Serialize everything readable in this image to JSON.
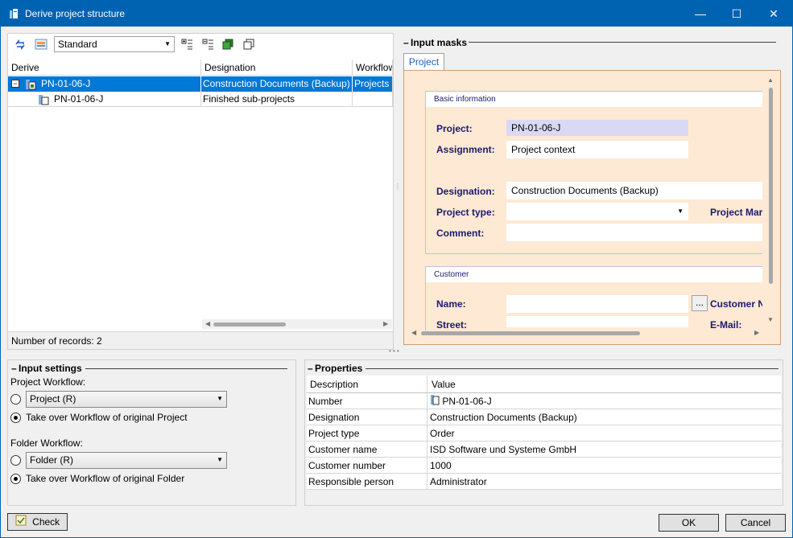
{
  "window": {
    "title": "Derive project structure"
  },
  "toolbar": {
    "view_combo": "Standard"
  },
  "tree": {
    "columns": [
      "Derive",
      "Designation",
      "Workflow"
    ],
    "rows": [
      {
        "derive": "PN-01-06-J",
        "designation": "Construction Documents (Backup)",
        "workflow": "Projects"
      },
      {
        "derive": "PN-01-06-J",
        "designation": "Finished sub-projects",
        "workflow": ""
      }
    ],
    "record_count": "Number of records: 2"
  },
  "input_masks": {
    "title": "Input masks",
    "tab": "Project",
    "basic_info": {
      "title": "Basic information",
      "project_label": "Project:",
      "project_value": "PN-01-06-J",
      "assignment_label": "Assignment:",
      "assignment_value": "Project context",
      "designation_label": "Designation:",
      "designation_value": "Construction Documents (Backup)",
      "project_type_label": "Project type:",
      "project_type_value": "",
      "project_manager_label": "Project Mar",
      "comment_label": "Comment:",
      "comment_value": ""
    },
    "customer": {
      "title": "Customer",
      "name_label": "Name:",
      "name_value": "",
      "browse_label": "...",
      "customer_number_label": "Customer N",
      "street_label": "Street:",
      "email_label": "E-Mail:"
    }
  },
  "input_settings": {
    "title": "Input settings",
    "project_workflow_label": "Project Workflow:",
    "project_workflow_combo": "Project (R)",
    "project_takeover": "Take over Workflow of original Project",
    "folder_workflow_label": "Folder Workflow:",
    "folder_workflow_combo": "Folder (R)",
    "folder_takeover": "Take over Workflow of original Folder"
  },
  "properties": {
    "title": "Properties",
    "columns": [
      "Description",
      "Value"
    ],
    "rows": [
      {
        "description": "Number",
        "value": "PN-01-06-J"
      },
      {
        "description": "Designation",
        "value": "Construction Documents (Backup)"
      },
      {
        "description": "Project type",
        "value": "Order"
      },
      {
        "description": "Customer name",
        "value": "ISD Software und Systeme GmbH"
      },
      {
        "description": "Customer number",
        "value": "1000"
      },
      {
        "description": "Responsible person",
        "value": "Administrator"
      }
    ]
  },
  "footer": {
    "check": "Check",
    "ok": "OK",
    "cancel": "Cancel"
  },
  "colors": {
    "titlebar": "#0063b1",
    "selection": "#0078d7",
    "mask_bg": "#fde9d4",
    "field_highlight": "#d9d9f3"
  }
}
